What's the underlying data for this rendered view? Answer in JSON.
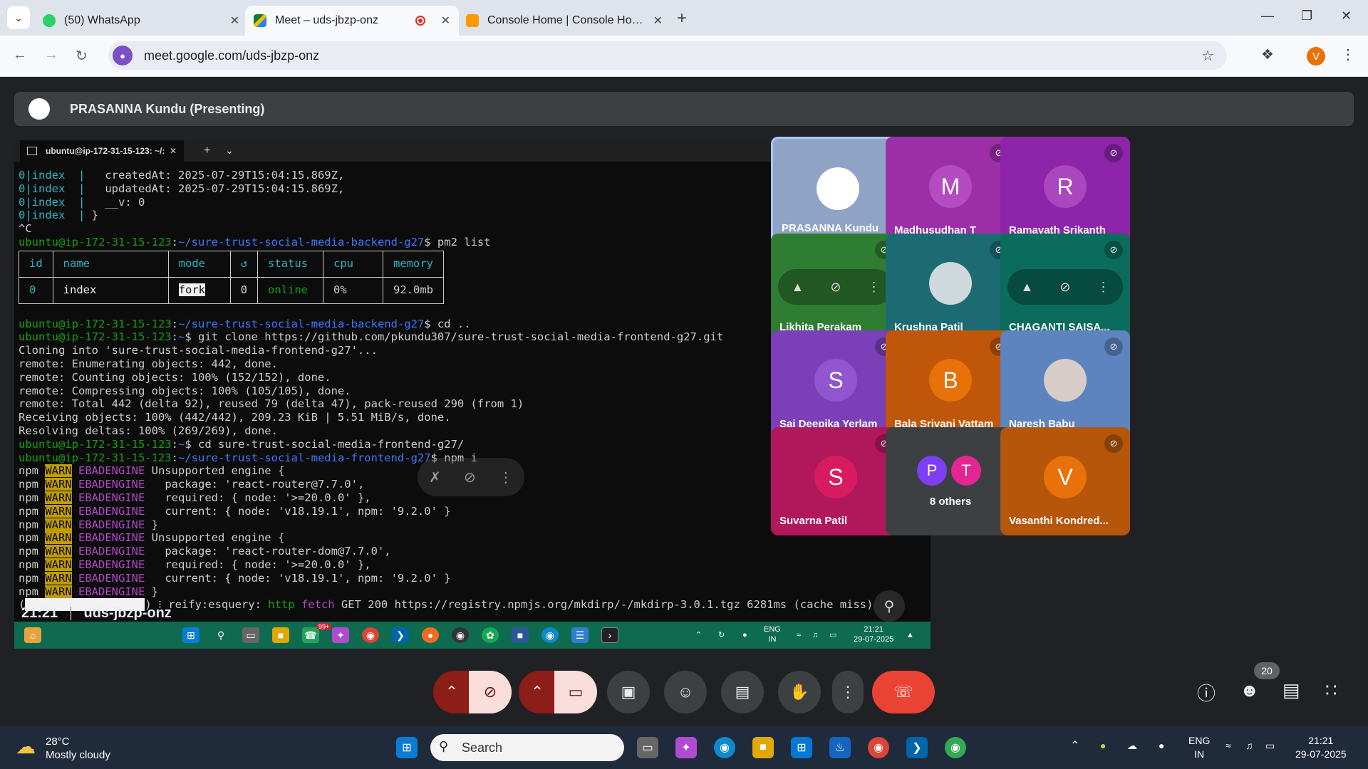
{
  "browser": {
    "tabs": [
      {
        "title": "(50) WhatsApp"
      },
      {
        "title": "Meet – uds-jbzp-onz"
      },
      {
        "title": "Console Home | Console Home"
      }
    ],
    "url": "meet.google.com/uds-jbzp-onz",
    "profile_initial": "V"
  },
  "meet": {
    "presenter_label": "PRASANNA Kundu (Presenting)",
    "time": "21:21",
    "meeting_code": "uds-jbzp-onz",
    "people_count": "20",
    "participants": [
      {
        "name": "PRASANNA Kundu",
        "initial": "",
        "bg": "#8fa3c4",
        "avatar_bg": "#ffffff"
      },
      {
        "name": "Madhusudhan T",
        "initial": "M",
        "bg": "#9c2fa8",
        "avatar_bg": "#b44bc0"
      },
      {
        "name": "Ramavath Srikanth",
        "initial": "R",
        "bg": "#8e24aa",
        "avatar_bg": "#ab47bc"
      },
      {
        "name": "Likhita Perakam",
        "initial": "",
        "bg": "#2f7d32",
        "avatar_bg": ""
      },
      {
        "name": "Krushna Patil",
        "initial": "",
        "bg": "#1c6b73",
        "avatar_bg": "#cfd8dc"
      },
      {
        "name": "CHAGANTI SAISA...",
        "initial": "",
        "bg": "#0b6b5c",
        "avatar_bg": ""
      },
      {
        "name": "Sai Deepika Yerlam",
        "initial": "S",
        "bg": "#7b3fb8",
        "avatar_bg": "#9155d0"
      },
      {
        "name": "Bala Srivani Vattam",
        "initial": "B",
        "bg": "#c0560a",
        "avatar_bg": "#e8710a"
      },
      {
        "name": "Naresh Babu",
        "initial": "",
        "bg": "#5e84bf",
        "avatar_bg": "#d7ccc8"
      },
      {
        "name": "Suvarna Patil",
        "initial": "S",
        "bg": "#b0185b",
        "avatar_bg": "#d81b60"
      },
      {
        "name": "8 others",
        "initial": "",
        "bg": "#3c4043",
        "avatar_bg": ""
      },
      {
        "name": "Vasanthi Kondred...",
        "initial": "V",
        "bg": "#b5560b",
        "avatar_bg": "#e8710a"
      }
    ],
    "others_initials": [
      "P",
      "T"
    ]
  },
  "terminal": {
    "tab_title": "ubuntu@ip-172-31-15-123: ~/:",
    "prompt_host": "ubuntu@ip-172-31-15-123",
    "pm2_headers": [
      "id",
      "name",
      "mode",
      "↺",
      "status",
      "cpu",
      "memory"
    ],
    "pm2_row": [
      "0",
      "index",
      "fork",
      "0",
      "online",
      "0%",
      "92.0mb"
    ]
  },
  "win_inner_taskbar": {
    "lang": "ENG",
    "region": "IN",
    "time": "21:21",
    "date": "29-07-2025",
    "badge": "99+"
  },
  "taskbar": {
    "weather_temp": "28°C",
    "weather_desc": "Mostly cloudy",
    "search_placeholder": "Search",
    "lang": "ENG",
    "region": "IN",
    "time": "21:21",
    "date": "29-07-2025"
  }
}
